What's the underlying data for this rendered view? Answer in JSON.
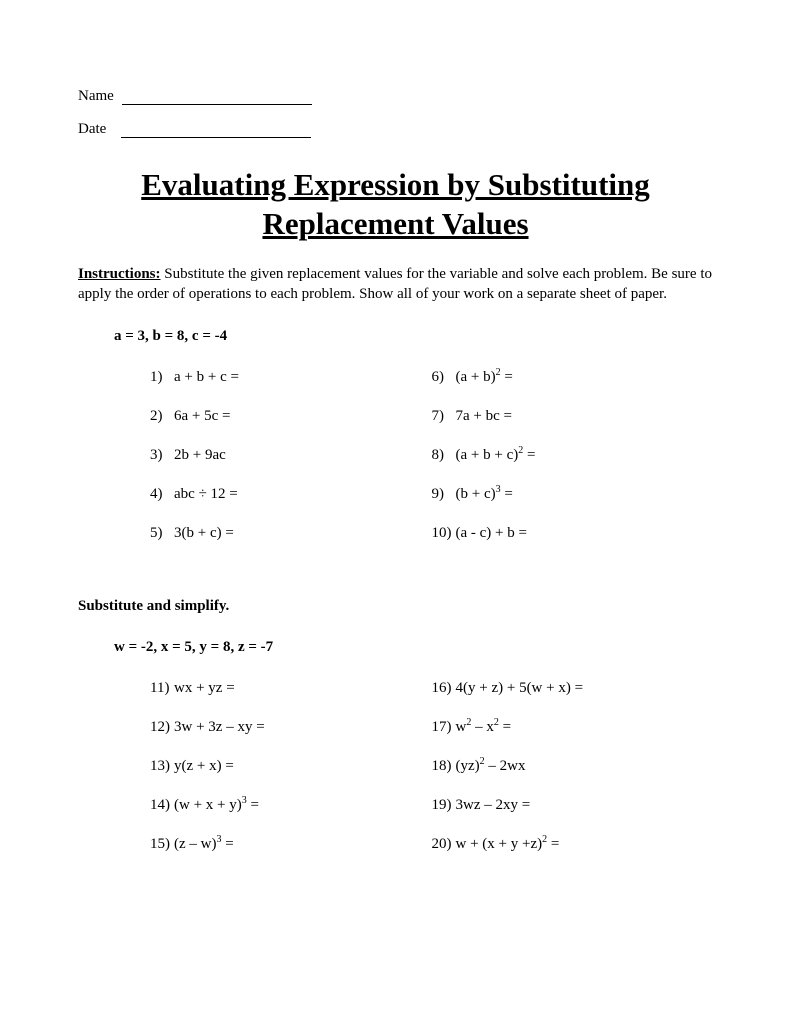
{
  "header": {
    "name_label": "Name",
    "date_label": "Date"
  },
  "title": "Evaluating Expression by Substituting Replacement Values",
  "instructions": {
    "label": "Instructions:",
    "text": " Substitute the given replacement values for the variable and solve each problem.  Be sure to apply the order of operations to each problem.  Show all of your work on a separate sheet of paper."
  },
  "section1": {
    "values": "a = 3, b = 8, c = -4",
    "left": [
      {
        "n": "1)",
        "expr": "a + b + c ="
      },
      {
        "n": "2)",
        "expr": "6a + 5c ="
      },
      {
        "n": "3)",
        "expr": "2b + 9ac"
      },
      {
        "n": "4)",
        "expr": "abc ÷ 12 ="
      },
      {
        "n": "5)",
        "expr": "3(b + c) ="
      }
    ],
    "right": [
      {
        "n": "6)",
        "expr_pre": "(a + b)",
        "sup": "2",
        "expr_post": " ="
      },
      {
        "n": "7)",
        "expr": "7a + bc ="
      },
      {
        "n": "8)",
        "expr_pre": "(a + b + c)",
        "sup": "2",
        "expr_post": " ="
      },
      {
        "n": "9)",
        "expr_pre": "(b + c)",
        "sup": "3",
        "expr_post": " ="
      },
      {
        "n": "10)",
        "expr": "(a - c) + b ="
      }
    ]
  },
  "section2": {
    "heading": "Substitute and simplify.",
    "values": "w = -2, x = 5, y = 8, z = -7",
    "left": [
      {
        "n": "11)",
        "expr": "wx + yz ="
      },
      {
        "n": "12)",
        "expr": "3w + 3z – xy ="
      },
      {
        "n": "13)",
        "expr": "y(z + x) ="
      },
      {
        "n": "14)",
        "expr_pre": "(w + x + y)",
        "sup": "3",
        "expr_post": " ="
      },
      {
        "n": "15)",
        "expr_pre": "(z – w)",
        "sup": "3",
        "expr_post": " ="
      }
    ],
    "right": [
      {
        "n": "16)",
        "expr": "4(y + z) + 5(w + x) ="
      },
      {
        "n": "17)",
        "expr_pre": "w",
        "sup": "2",
        "expr_mid": " – x",
        "sup2": "2",
        "expr_post": " ="
      },
      {
        "n": "18)",
        "expr_pre": "(yz)",
        "sup": "2",
        "expr_post": " – 2wx"
      },
      {
        "n": "19)",
        "expr": "3wz – 2xy ="
      },
      {
        "n": "20)",
        "expr_pre": "w + (x + y +z)",
        "sup": "2",
        "expr_post": " ="
      }
    ]
  }
}
